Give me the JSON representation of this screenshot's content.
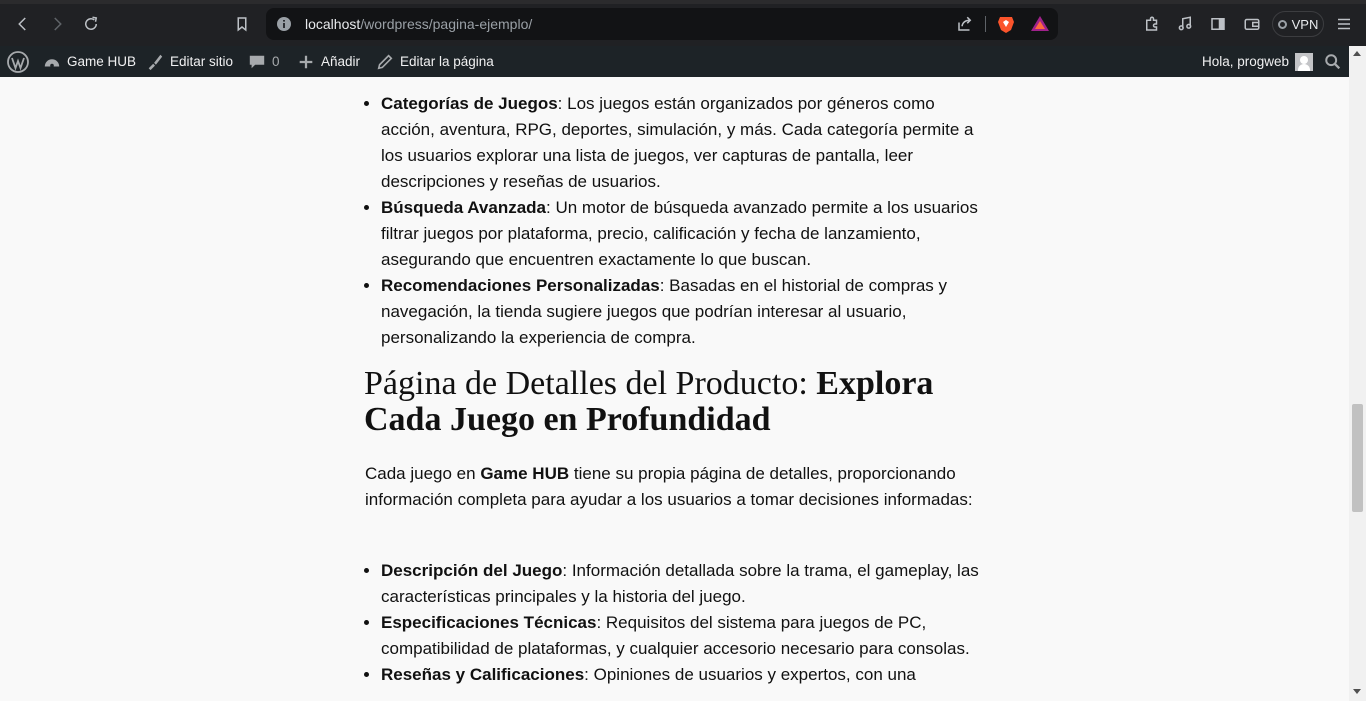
{
  "browser": {
    "url_host": "localhost",
    "url_path": "/wordpress/pagina-ejemplo/",
    "vpn_label": "VPN"
  },
  "admin_bar": {
    "site_name": "Game HUB",
    "edit_site": "Editar sitio",
    "comments_count": "0",
    "add_new": "Añadir",
    "edit_page": "Editar la página",
    "greeting": "Hola, progweb"
  },
  "content": {
    "list1": [
      {
        "term": "Categorías de Juegos",
        "text": ": Los juegos están organizados por géneros como acción, aventura, RPG, deportes, simulación, y más. Cada categoría permite a los usuarios explorar una lista de juegos, ver capturas de pantalla, leer descripciones y reseñas de usuarios."
      },
      {
        "term": "Búsqueda Avanzada",
        "text": ": Un motor de búsqueda avanzado permite a los usuarios filtrar juegos por plataforma, precio, calificación y fecha de lanzamiento, asegurando que encuentren exactamente lo que buscan."
      },
      {
        "term": "Recomendaciones Personalizadas",
        "text": ": Basadas en el historial de compras y navegación, la tienda sugiere juegos que podrían interesar al usuario, personalizando la experiencia de compra."
      }
    ],
    "heading_light": "Página de Detalles del Producto: ",
    "heading_bold": "Explora Cada Juego en Profundidad",
    "para_before": "Cada juego en ",
    "para_bold": "Game HUB",
    "para_after": " tiene su propia página de detalles, proporcionando información completa para ayudar a los usuarios a tomar decisiones informadas:",
    "list2": [
      {
        "term": "Descripción del Juego",
        "text": ": Información detallada sobre la trama, el gameplay, las características principales y la historia del juego."
      },
      {
        "term": "Especificaciones Técnicas",
        "text": ": Requisitos del sistema para juegos de PC, compatibilidad de plataformas, y cualquier accesorio necesario para consolas."
      },
      {
        "term": "Reseñas y Calificaciones",
        "text": ": Opiniones de usuarios y expertos, con una"
      }
    ]
  }
}
